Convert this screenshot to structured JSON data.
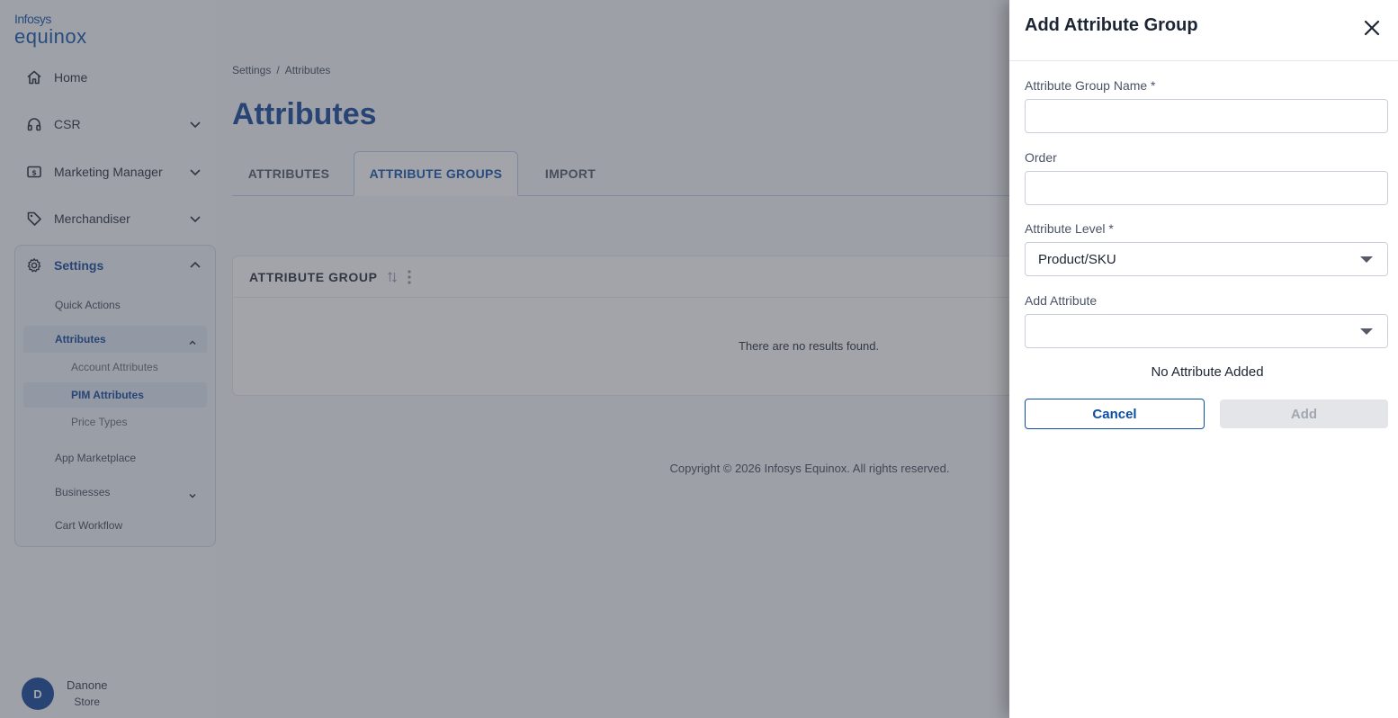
{
  "brand": {
    "line1": "Infosys",
    "line2": "equinox"
  },
  "sidebar": {
    "nav": [
      {
        "label": "Home",
        "icon": "home-icon"
      },
      {
        "label": "CSR",
        "icon": "headset-icon"
      },
      {
        "label": "Marketing Manager",
        "icon": "dollar-card-icon"
      },
      {
        "label": "Merchandiser",
        "icon": "tag-icon"
      },
      {
        "label": "Settings",
        "icon": "gear-icon"
      }
    ],
    "settings_items": {
      "quick_actions": "Quick Actions",
      "attributes": "Attributes",
      "account_attributes": "Account Attributes",
      "pim_attributes": "PIM Attributes",
      "price_types": "Price Types",
      "app_marketplace": "App Marketplace",
      "businesses": "Businesses",
      "cart_workflow": "Cart Workflow"
    },
    "user": {
      "initial": "D",
      "name": "Danone",
      "store": "Store"
    }
  },
  "main": {
    "breadcrumb": [
      "Settings",
      "/",
      "Attributes"
    ],
    "title": "Attributes",
    "tabs": [
      {
        "label": "ATTRIBUTES",
        "active": false
      },
      {
        "label": "ATTRIBUTE GROUPS",
        "active": true
      },
      {
        "label": "IMPORT",
        "active": false
      }
    ],
    "grid": {
      "column": "ATTRIBUTE GROUP",
      "empty_message": "There are no results found."
    },
    "copyright": "Copyright © 2026 Infosys Equinox. All rights reserved."
  },
  "drawer": {
    "title": "Add Attribute Group",
    "fields": {
      "group_name": {
        "label": "Attribute Group Name *",
        "value": ""
      },
      "order": {
        "label": "Order",
        "value": ""
      },
      "level": {
        "label": "Attribute Level *",
        "value": "Product/SKU"
      },
      "add_attribute": {
        "label": "Add Attribute",
        "value": ""
      }
    },
    "no_attribute_text": "No Attribute Added",
    "cancel_label": "Cancel",
    "add_label": "Add"
  },
  "colors": {
    "primary": "#0a4ea8",
    "title_blue": "#0a3f97",
    "overlay": "#464a54",
    "disabled_bg": "#e4e5e8"
  }
}
